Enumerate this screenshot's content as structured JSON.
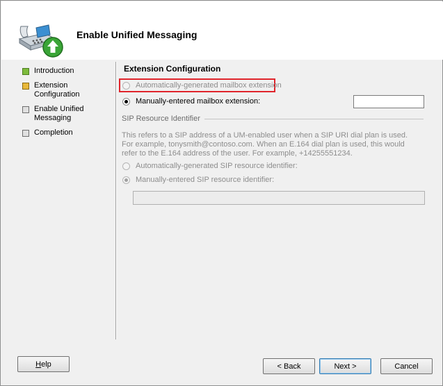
{
  "header": {
    "title": "Enable Unified Messaging",
    "icon": "phone-with-green-arrow-icon"
  },
  "steps": [
    {
      "label": "Introduction",
      "status": "done"
    },
    {
      "label": "Extension Configuration",
      "status": "current"
    },
    {
      "label": "Enable Unified Messaging",
      "status": "pending"
    },
    {
      "label": "Completion",
      "status": "pending"
    }
  ],
  "content": {
    "section_title": "Extension Configuration",
    "auto_extension_label": "Automatically-generated mailbox extension",
    "manual_extension_label": "Manually-entered mailbox extension:",
    "manual_extension_value": "",
    "sip_group_label": "SIP Resource Identifier",
    "sip_description": "This refers to a SIP address of a UM-enabled user when a SIP URI dial plan is used. For example, tonysmith@contoso.com. When an E.164 dial plan is used, this would refer to the E.164 address of the user. For example, +14255551234.",
    "auto_sip_label": "Automatically-generated SIP resource identifier:",
    "manual_sip_label": "Manually-entered SIP resource identifier:",
    "manual_sip_value": ""
  },
  "buttons": {
    "help": "Help",
    "back": "< Back",
    "next": "Next >",
    "cancel": "Cancel"
  },
  "colors": {
    "highlight": "#e0242b",
    "step_done": "#7dbb3c",
    "step_current": "#e8b83a"
  }
}
